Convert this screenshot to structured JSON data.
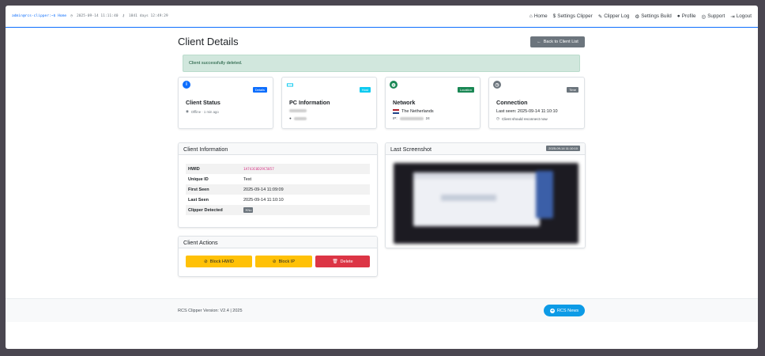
{
  "topbar": {
    "prompt": "admin@rcs-clipper:~$ Home",
    "datetime": "2025-09-14 11:11:40",
    "uptime": "1841 days 12:49:29"
  },
  "nav": {
    "items": [
      {
        "label": "Home",
        "icon": "home-icon",
        "glyph": "⌂"
      },
      {
        "label": "Settings Clipper",
        "icon": "dollar-icon",
        "glyph": "$"
      },
      {
        "label": "Clipper Log",
        "icon": "pencil-icon",
        "glyph": "✎"
      },
      {
        "label": "Settings Build",
        "icon": "gear-icon",
        "glyph": "⚙"
      },
      {
        "label": "Profile",
        "icon": "user-icon",
        "glyph": "👤"
      },
      {
        "label": "Support",
        "icon": "lifering-icon",
        "glyph": "◎"
      },
      {
        "label": "Logout",
        "icon": "logout-icon",
        "glyph": "⇥"
      }
    ]
  },
  "page": {
    "title": "Client Details",
    "back_label": "Back to Client List",
    "alert": "Client successfully deleted."
  },
  "stats": {
    "status": {
      "title": "Client Status",
      "badge": "Details",
      "value": "Offline · 1 min ago",
      "color": "#0d6efd"
    },
    "pc": {
      "title": "PC Information",
      "badge": "Host",
      "color": "#0dcaf0"
    },
    "network": {
      "title": "Network",
      "badge": "Location",
      "country": "The Netherlands",
      "ip_label": "IP:",
      "ip_suffix": "24",
      "color": "#198754"
    },
    "connection": {
      "title": "Connection",
      "badge": "Time",
      "last_seen": "Last seen: 2025-09-14 11:10:10",
      "note": "Client should reconnect now",
      "color": "#6c757d"
    }
  },
  "client_info": {
    "header": "Client Information",
    "rows": [
      {
        "key": "HWID",
        "value": "1A743C0D29C5857"
      },
      {
        "key": "Unique ID",
        "value": "Test"
      },
      {
        "key": "First Seen",
        "value": "2025-09-14 11:09:09"
      },
      {
        "key": "Last Seen",
        "value": "2025-09-14 11:10:10"
      },
      {
        "key": "Clipper Detected",
        "value": "No"
      }
    ]
  },
  "actions": {
    "header": "Client Actions",
    "block_hwid": "Block HWID",
    "block_ip": "Block IP",
    "delete": "Delete"
  },
  "screenshot": {
    "header": "Last Screenshot",
    "timestamp": "2025-09-14 11:10:10"
  },
  "footer": {
    "version": "RCS Clipper Version: V2.4 | 2025",
    "news": "RCS News"
  }
}
